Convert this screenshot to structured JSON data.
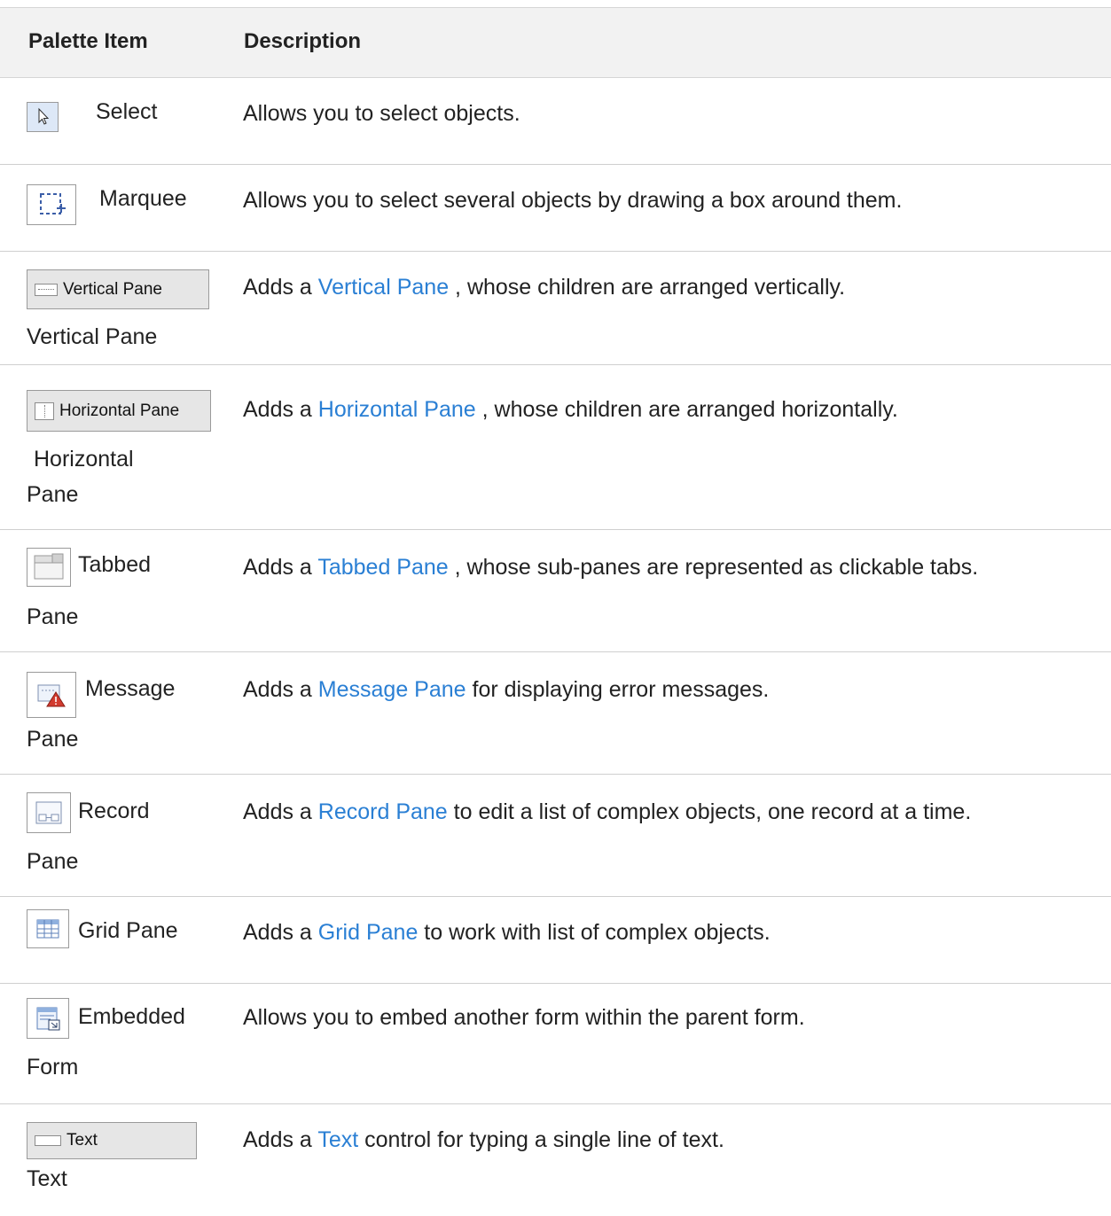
{
  "header": {
    "col1": "Palette Item",
    "col2": "Description"
  },
  "rows": [
    {
      "label": "Select",
      "desc_pre": "Allows you to select objects.",
      "link": "",
      "desc_post": ""
    },
    {
      "label": "Marquee",
      "desc_pre": "Allows you to select several objects by drawing a box around them.",
      "link": "",
      "desc_post": ""
    },
    {
      "label": "Vertical Pane",
      "icon_text": "Vertical Pane",
      "desc_pre": "Adds a ",
      "link": "Vertical Pane",
      "desc_post": " , whose children are arranged vertically."
    },
    {
      "label_l1": "Horizontal",
      "label_l2": "Pane",
      "icon_text": "Horizontal Pane",
      "desc_pre": "Adds a ",
      "link": "Horizontal Pane",
      "desc_post": " , whose children are arranged horizontally."
    },
    {
      "label_l1": "Tabbed",
      "label_l2": "Pane",
      "desc_pre": "Adds a ",
      "link": "Tabbed Pane",
      "desc_post": " , whose sub-panes are represented as clickable tabs."
    },
    {
      "label_l1": "Message",
      "label_l2": "Pane",
      "desc_pre": "Adds a ",
      "link": "Message Pane",
      "desc_post": " for displaying error messages."
    },
    {
      "label_l1": "Record",
      "label_l2": "Pane",
      "desc_pre": "Adds a ",
      "link": "Record Pane",
      "desc_post": " to edit a list of complex objects, one record at a time."
    },
    {
      "label": "Grid Pane",
      "desc_pre": "Adds a ",
      "link": "Grid Pane",
      "desc_post": " to work with list of complex objects."
    },
    {
      "label_l1": "Embedded",
      "label_l2": "Form",
      "desc_pre": "Allows you to embed another form within the parent form.",
      "link": "",
      "desc_post": ""
    },
    {
      "label": "Text",
      "icon_text": "Text",
      "desc_pre": "Adds a ",
      "link": "Text",
      "desc_post": " control for typing a single line of text."
    }
  ]
}
